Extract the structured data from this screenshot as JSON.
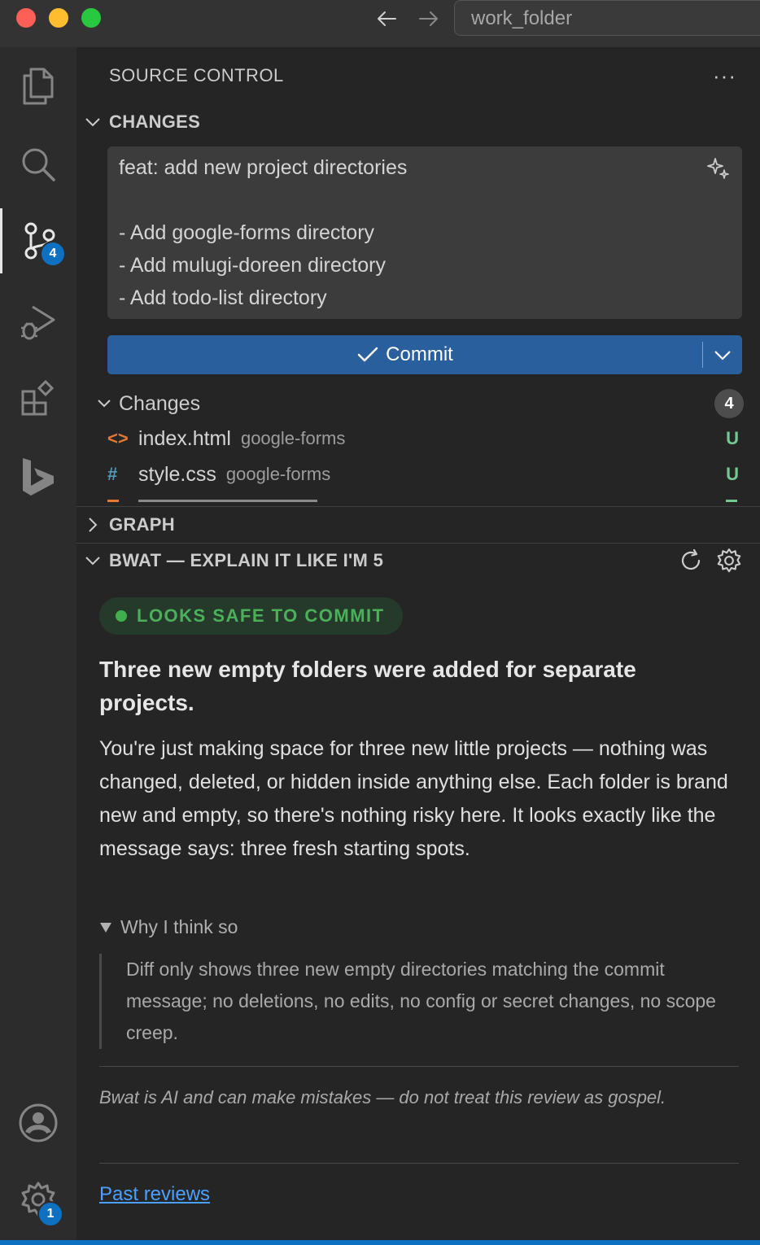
{
  "titlebar": {
    "search_text": "work_folder"
  },
  "activity": {
    "scm_badge": "4",
    "settings_badge": "1"
  },
  "sidebar": {
    "title": "SOURCE CONTROL",
    "more": "···",
    "changes_section": "CHANGES",
    "commit_message": [
      "feat: add new project directories",
      "",
      "- Add google-forms directory",
      "- Add mulugi-doreen directory",
      "- Add todo-list directory"
    ],
    "commit_label": "Commit",
    "changes_group": {
      "label": "Changes",
      "count": "4"
    },
    "files": [
      {
        "icon": "<>",
        "icon_color": "#e37933",
        "name": "index.html",
        "dir": "google-forms",
        "status": "U"
      },
      {
        "icon": "#",
        "icon_color": "#519aba",
        "name": "style.css",
        "dir": "google-forms",
        "status": "U"
      }
    ],
    "graph_section": "GRAPH",
    "bwat_section": "BWAT — EXPLAIN IT LIKE I'M 5"
  },
  "bwat": {
    "verdict": "LOOKS SAFE TO COMMIT",
    "verdict_color": "#3fb04b",
    "headline": "Three new empty folders were added for separate projects.",
    "explanation": "You're just making space for three new little projects — nothing was changed, deleted, or hidden inside anything else. Each folder is brand new and empty, so there's nothing risky here. It looks exactly like the message says: three fresh starting spots.",
    "why_label": "Why I think so",
    "why_text": "Diff only shows three new empty directories matching the commit message; no deletions, no edits, no config or secret changes, no scope creep.",
    "disclaimer": "Bwat is AI and can make mistakes — do not treat this review as gospel.",
    "past_reviews": "Past reviews"
  }
}
